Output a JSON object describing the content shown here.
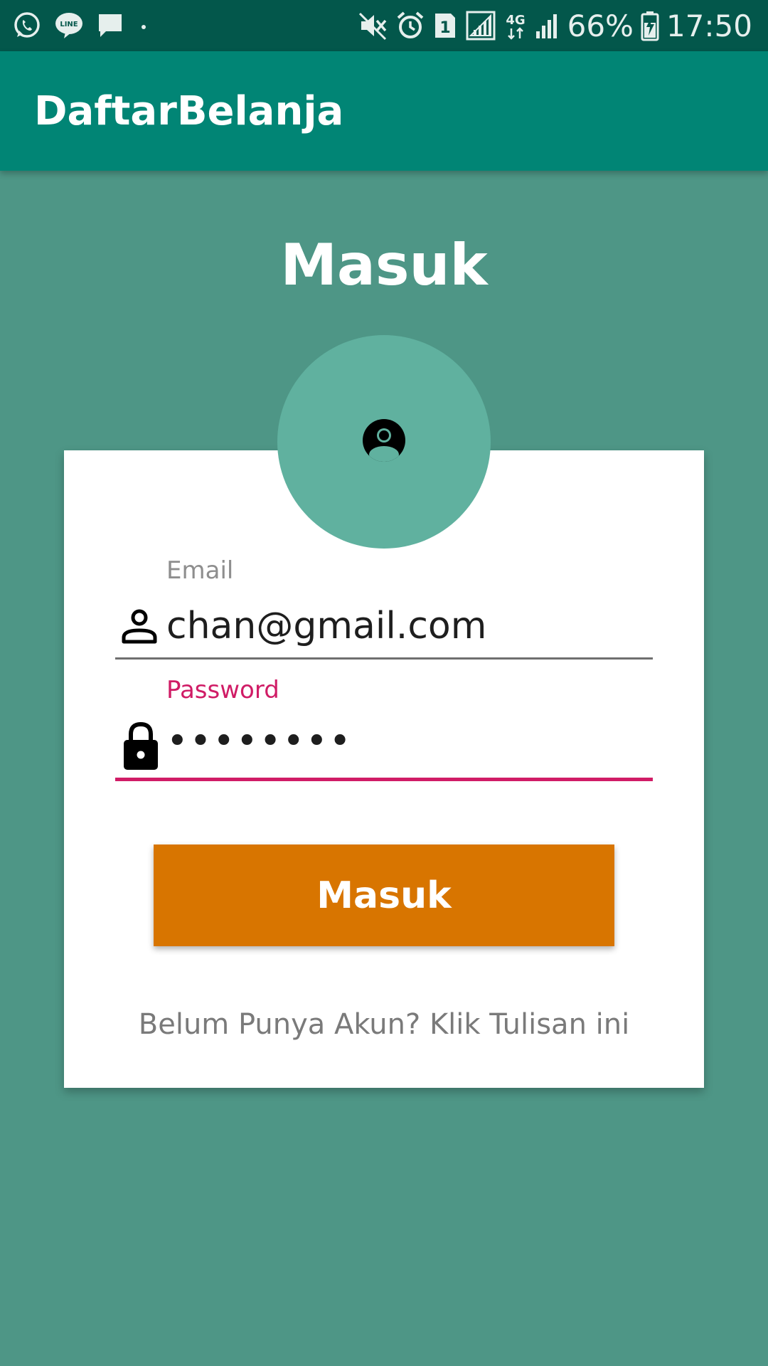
{
  "status_bar": {
    "battery_percent": "66%",
    "time": "17:50",
    "sim_slot": "1",
    "network": "4G",
    "icons": [
      "whatsapp-icon",
      "line-icon",
      "message-icon",
      "dot-icon",
      "mute-icon",
      "alarm-icon",
      "sim-icon",
      "signal-icon",
      "network-4g-icon",
      "signal-icon",
      "battery-charging-icon"
    ]
  },
  "app_bar": {
    "title": "DaftarBelanja"
  },
  "login": {
    "heading": "Masuk",
    "avatar_icon": "account-circle-icon",
    "email": {
      "label": "Email",
      "value": "chan@gmail.com",
      "icon": "person-icon"
    },
    "password": {
      "label": "Password",
      "value": "••••••••",
      "icon": "lock-icon"
    },
    "submit_label": "Masuk",
    "register_link": "Belum Punya Akun? Klik Tulisan ini"
  },
  "colors": {
    "status_bar": "#03574b",
    "app_bar": "#018575",
    "background": "#4e9686",
    "avatar": "#60b19f",
    "accent": "#d01c66",
    "button": "#d87500"
  }
}
